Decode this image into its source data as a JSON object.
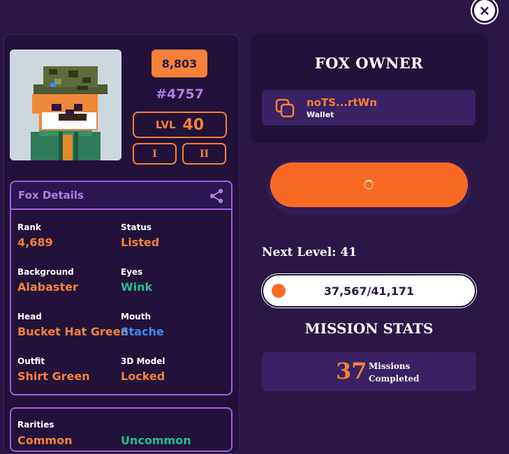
{
  "close_label": "×",
  "nft": {
    "rank_badge": "8,803",
    "token_id": "#4757",
    "level_label": "LVL",
    "level_value": "40",
    "gen_buttons": [
      "I",
      "II"
    ]
  },
  "details": {
    "title": "Fox Details",
    "traits": [
      {
        "label": "Rank",
        "value": "4,689",
        "color": "#f5813a"
      },
      {
        "label": "Status",
        "value": "Listed",
        "color": "#f5813a"
      },
      {
        "label": "Background",
        "value": "Alabaster",
        "color": "#f5813a"
      },
      {
        "label": "Eyes",
        "value": "Wink",
        "color": "#22c08a"
      },
      {
        "label": "Head",
        "value": "Bucket Hat Green",
        "color": "#f5813a"
      },
      {
        "label": "Mouth",
        "value": "Stache",
        "color": "#3b8df5"
      },
      {
        "label": "Outfit",
        "value": "Shirt Green",
        "color": "#f5813a"
      },
      {
        "label": "3D Model",
        "value": "Locked",
        "color": "#f5813a"
      }
    ]
  },
  "rarities": {
    "title": "Rarities",
    "values": [
      "Common",
      "Uncommon"
    ]
  },
  "owner": {
    "title": "FOX OWNER",
    "wallet_address": "noTS...rtWn",
    "wallet_label": "Wallet"
  },
  "progress": {
    "next_level_label": "Next Level: 41",
    "current_xp": 37567,
    "target_xp": 41171,
    "xp_text": "37,567/41,171",
    "fill_fraction": 0.06
  },
  "missions": {
    "title": "MISSION STATS",
    "count": "37",
    "label_line1": "Missions",
    "label_line2": "Completed"
  },
  "colors": {
    "background": "#2a1745",
    "accent": "#f5813a",
    "purple": "#a05fe0"
  }
}
